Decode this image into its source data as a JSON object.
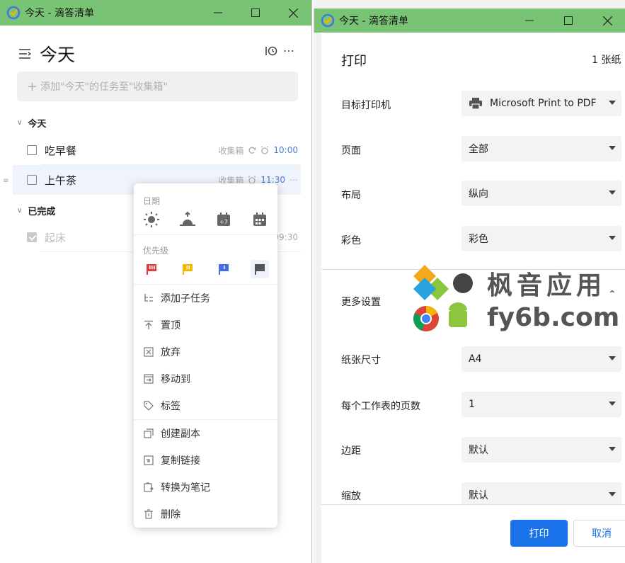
{
  "left_window": {
    "title": "今天 - 滴答清单",
    "page_title": "今天",
    "add_placeholder": "添加\"今天\"的任务至\"收集箱\"",
    "sections": {
      "today": "今天",
      "completed": "已完成"
    },
    "tasks": [
      {
        "name": "吃早餐",
        "list": "收集箱",
        "time": "10:00"
      },
      {
        "name": "上午茶",
        "list": "收集箱",
        "time": "11:30"
      }
    ],
    "completed_tasks": [
      {
        "name": "起床",
        "time": "09:30"
      }
    ],
    "context_menu": {
      "date_label": "日期",
      "priority_label": "优先级",
      "priority_colors": [
        "#e03e3e",
        "#f5b400",
        "#3f6fe0",
        "#555555"
      ],
      "items": [
        "添加子任务",
        "置顶",
        "放弃",
        "移动到",
        "标签",
        "创建副本",
        "复制链接",
        "转换为笔记",
        "删除"
      ]
    }
  },
  "right_window": {
    "title": "今天 - 滴答清单",
    "print": {
      "title": "打印",
      "sheet_count": "1 张纸",
      "rows": [
        {
          "label": "目标打印机",
          "value": "Microsoft Print to PDF"
        },
        {
          "label": "页面",
          "value": "全部"
        },
        {
          "label": "布局",
          "value": "纵向"
        },
        {
          "label": "彩色",
          "value": "彩色"
        }
      ],
      "more_settings": "更多设置",
      "more_rows": [
        {
          "label": "纸张尺寸",
          "value": "A4"
        },
        {
          "label": "每个工作表的页数",
          "value": "1"
        },
        {
          "label": "边距",
          "value": "默认"
        },
        {
          "label": "缩放",
          "value": "默认"
        }
      ],
      "print_button": "打印",
      "cancel_button": "取消"
    }
  },
  "watermark": {
    "cn": "枫音应用",
    "en": "fy6b.com"
  }
}
